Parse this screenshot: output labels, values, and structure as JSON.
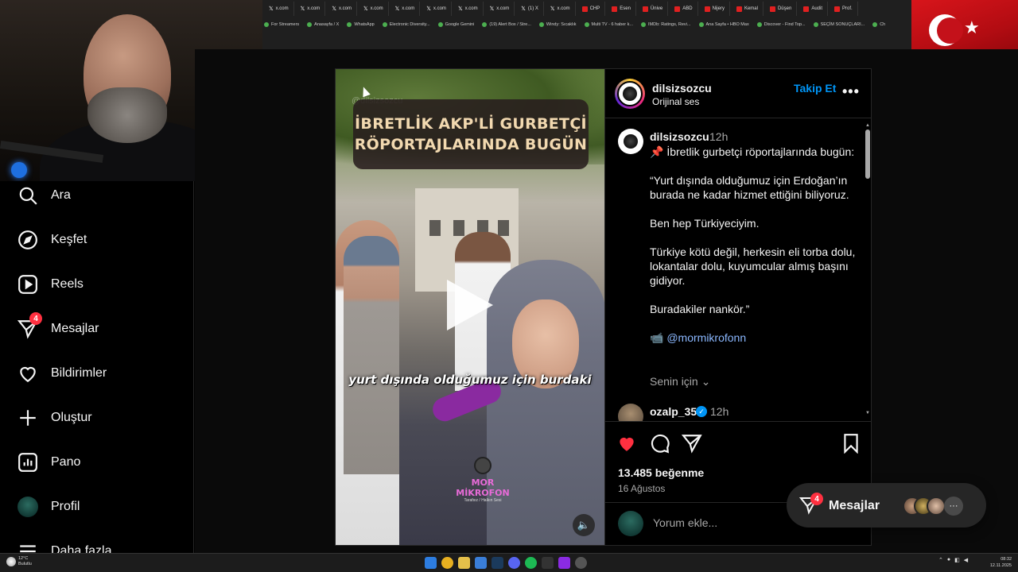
{
  "browser": {
    "tabs": [
      {
        "label": "x.com",
        "icon": "x-icon"
      },
      {
        "label": "x.com",
        "icon": "x-icon"
      },
      {
        "label": "x.com",
        "icon": "x-icon"
      },
      {
        "label": "x.com",
        "icon": "x-icon"
      },
      {
        "label": "x.com",
        "icon": "x-icon"
      },
      {
        "label": "x.com",
        "icon": "x-icon"
      },
      {
        "label": "x.com",
        "icon": "x-icon"
      },
      {
        "label": "x.com",
        "icon": "x-icon"
      },
      {
        "label": "(1) X",
        "icon": "x-icon"
      },
      {
        "label": "x.com",
        "icon": "x-icon"
      },
      {
        "label": "CHP",
        "icon": "news-icon"
      },
      {
        "label": "Esen",
        "icon": "news-icon"
      },
      {
        "label": "Ünive",
        "icon": "news-icon"
      },
      {
        "label": "ABD",
        "icon": "news-icon"
      },
      {
        "label": "Nijery",
        "icon": "news-icon"
      },
      {
        "label": "Kemal",
        "icon": "news-icon"
      },
      {
        "label": "Düşen",
        "icon": "news-icon"
      },
      {
        "label": "Audit",
        "icon": "news-icon"
      },
      {
        "label": "Prof.",
        "icon": "news-icon"
      }
    ],
    "bookmarks": [
      "For Streamers",
      "Anasayfa / X",
      "WhatsApp",
      "Electronic Diversity...",
      "Google Gemini",
      "(19) Alert Box / Stre...",
      "Windy: Sıcaklık",
      "Multi TV - 6 haber k...",
      "IMDb: Ratings, Revi...",
      "Ana Sayfa • HBO Max",
      "Discover - Find Top...",
      "SEÇİM SONUÇLARI...",
      "Ch"
    ]
  },
  "sidebar": {
    "items": [
      {
        "label": "Ara",
        "icon": "search-icon"
      },
      {
        "label": "Keşfet",
        "icon": "compass-icon"
      },
      {
        "label": "Reels",
        "icon": "reels-icon"
      },
      {
        "label": "Mesajlar",
        "icon": "messenger-icon",
        "badge": "4"
      },
      {
        "label": "Bildirimler",
        "icon": "heart-icon"
      },
      {
        "label": "Oluştur",
        "icon": "plus-icon"
      },
      {
        "label": "Pano",
        "icon": "dashboard-icon"
      },
      {
        "label": "Profil",
        "icon": "avatar"
      },
      {
        "label": "Daha fazla",
        "icon": "menu-icon"
      }
    ]
  },
  "video": {
    "watermark": "@dilsizsozcu",
    "headline_line1": "İBRETLİK AKP'Lİ GURBETÇİ",
    "headline_line2": "RÖPORTAJLARINDA BUGÜN",
    "subtitle": "yurt dışında olduğumuz için burdaki",
    "logo_title": "MOR MİKROFON",
    "logo_sub": "Tarafsız / Halkın Sesi"
  },
  "post": {
    "username": "dilsizsozcu",
    "audio": "Orijinal ses",
    "follow_label": "Takip Et",
    "more_label": "•••",
    "caption": {
      "username": "dilsizsozcu",
      "time": "12h",
      "pin": "📌",
      "p1": "İbretlik gurbetçi röportajlarında bugün:",
      "p2": "“Yurt dışında olduğumuz için Erdoğan’ın burada ne kadar hizmet ettiğini biliyoruz.",
      "p3": "Ben hep Türkiyeciyim.",
      "p4": "Türkiye kötü değil, herkesin eli torba dolu, lokantalar dolu, kuyumcular almış başını gidiyor.",
      "p5": "Buradakiler nankör.”",
      "camera": "📹",
      "mention": "@mormikrofonn"
    },
    "for_you": "Senin için ⌄",
    "comment2": {
      "username": "ozalp_35",
      "time": "12h",
      "verified": "✓"
    },
    "likes": "13.485 beğenme",
    "date": "16 Ağustos",
    "comment_placeholder": "Yorum ekle..."
  },
  "messages_pill": {
    "label": "Mesajlar",
    "badge": "4",
    "more": "···"
  },
  "taskbar": {
    "weather_temp": "12°C",
    "weather_desc": "Bulutlu",
    "time": "08:32",
    "date": "12.11.2025"
  },
  "colors": {
    "accent": "#0095f6",
    "badge": "#ff3040",
    "like": "#ff3040"
  }
}
